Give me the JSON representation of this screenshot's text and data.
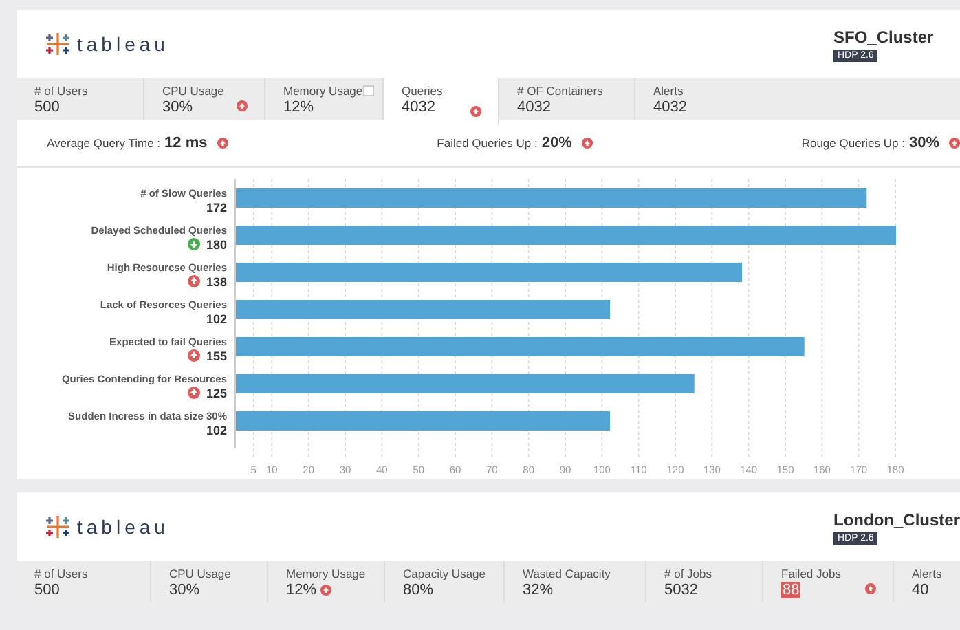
{
  "clusters": [
    {
      "logo": "tableau",
      "name": "SFO_Cluster",
      "badge": "HDP 2.6",
      "tabs": [
        {
          "label": "# of Users",
          "value": "500",
          "selected": false,
          "kind": "plain",
          "highlight": false
        },
        {
          "label": "CPU Usage",
          "value": "30%",
          "selected": false,
          "kind": "alert",
          "highlight": false
        },
        {
          "label": "Memory Usage",
          "value": "12%",
          "selected": false,
          "kind": "checkbox",
          "highlight": false
        },
        {
          "label": "Queries",
          "value": "4032",
          "selected": true,
          "kind": "alert",
          "highlight": false
        },
        {
          "label": "# OF Containers",
          "value": "4032",
          "selected": false,
          "kind": "plain",
          "highlight": false
        },
        {
          "label": "Alerts",
          "value": "4032",
          "selected": false,
          "kind": "plain",
          "highlight": false
        }
      ],
      "metrics": [
        {
          "label": "Average Query Time :",
          "value": "12 ms"
        },
        {
          "label": "Failed Queries Up :",
          "value": "20%"
        },
        {
          "label": "Rouge Queries Up :",
          "value": "30%"
        }
      ],
      "row_indicators": [
        {
          "kind": "none"
        },
        {
          "kind": "down"
        },
        {
          "kind": "up"
        },
        {
          "kind": "none"
        },
        {
          "kind": "up"
        },
        {
          "kind": "up"
        },
        {
          "kind": "none"
        }
      ],
      "chart_data": {
        "type": "bar",
        "orientation": "horizontal",
        "categories": [
          "# of Slow Queries",
          "Delayed Scheduled Queries",
          "High Resourcse Queries",
          "Lack of Resorces Queries",
          "Expected to fail Queries",
          "Quries Contending for Resources",
          "Sudden Incress in data size 30%"
        ],
        "value_labels": [
          "172",
          "180",
          "138",
          "102",
          "155",
          "125",
          "102"
        ],
        "series": [
          {
            "color": "#52a5d4",
            "values": [
              172,
              180,
              138,
              102,
              155,
              125,
              102
            ]
          }
        ],
        "grid": true,
        "xlim": [
          0,
          180
        ],
        "xticks": [
          5,
          10,
          20,
          30,
          40,
          50,
          60,
          70,
          80,
          90,
          100,
          110,
          120,
          130,
          140,
          150,
          160,
          170,
          180
        ]
      }
    },
    {
      "logo": "tableau",
      "name": "London_Cluster",
      "badge": "HDP 2.6",
      "tabs": [
        {
          "label": "# of Users",
          "value": "500",
          "selected": false,
          "kind": "plain",
          "highlight": false
        },
        {
          "label": "CPU Usage",
          "value": "30%",
          "selected": false,
          "kind": "plain",
          "highlight": false
        },
        {
          "label": "Memory Usage",
          "value": "12%",
          "selected": false,
          "kind": "inline-alert",
          "highlight": false
        },
        {
          "label": "Capacity Usage",
          "value": "80%",
          "selected": false,
          "kind": "plain",
          "highlight": false
        },
        {
          "label": "Wasted Capacity",
          "value": "32%",
          "selected": false,
          "kind": "plain",
          "highlight": false
        },
        {
          "label": "# of Jobs",
          "value": "5032",
          "selected": false,
          "kind": "plain",
          "highlight": false
        },
        {
          "label": "Failed Jobs",
          "value": "88",
          "selected": false,
          "kind": "alert",
          "highlight": true
        },
        {
          "label": "Alerts",
          "value": "40",
          "selected": false,
          "kind": "plain",
          "highlight": false
        }
      ]
    }
  ]
}
